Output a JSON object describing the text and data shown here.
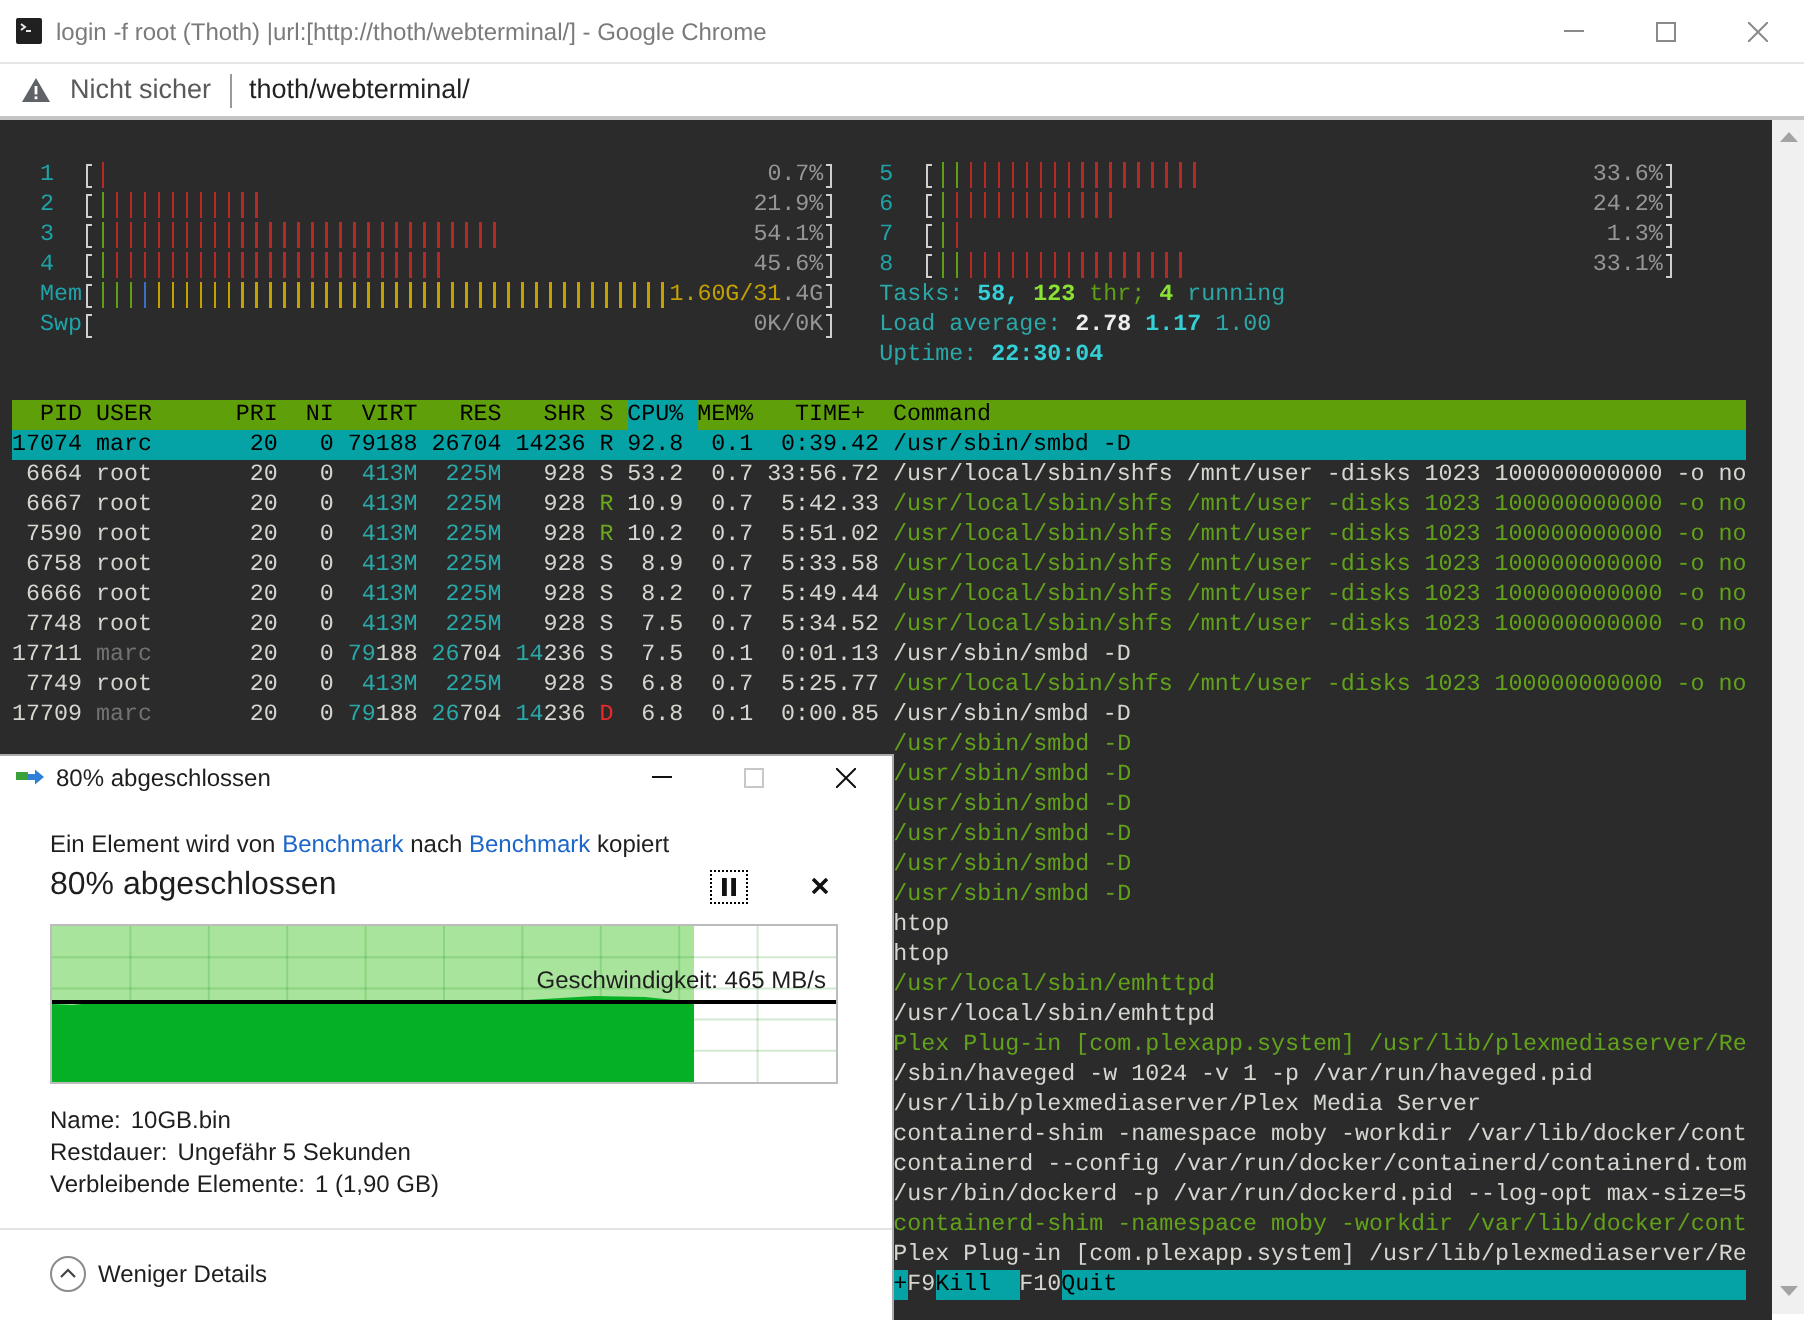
{
  "window": {
    "title": "login -f root (Thoth) |url:[http://thoth/webterminal/] - Google Chrome"
  },
  "address_bar": {
    "security_label": "Nicht sicher",
    "url": "thoth/webterminal/"
  },
  "terminal": {
    "left_meters": [
      {
        "label": "1",
        "segments": [
          {
            "color": "#b52a24",
            "level": 0.019
          }
        ],
        "reading": "0.7%"
      },
      {
        "label": "2",
        "segments": [
          {
            "color": "#5c9e14",
            "level": 0.019
          },
          {
            "color": "#b52a24",
            "level": 0.231
          }
        ],
        "reading": "21.9%"
      },
      {
        "label": "3",
        "segments": [
          {
            "color": "#5c9e14",
            "level": 0.019
          },
          {
            "color": "#b52a24",
            "level": 0.558
          }
        ],
        "reading": "54.1%"
      },
      {
        "label": "4",
        "segments": [
          {
            "color": "#5c9e14",
            "level": 0.019
          },
          {
            "color": "#b52a24",
            "level": 0.481
          }
        ],
        "reading": "45.6%"
      },
      {
        "label": "Mem",
        "segments": [
          {
            "color": "#5c9e14",
            "level": 0.058
          },
          {
            "color": "#3a6fc8",
            "level": 0.077
          },
          {
            "color": "#c4a000",
            "level": 0.942
          }
        ],
        "reading": "1.60G/31.4G"
      },
      {
        "label": "Swp",
        "reading": "0K/0K"
      }
    ],
    "right_meters": [
      {
        "label": "5",
        "segments": [
          {
            "color": "#5c9e14",
            "level": 0.038
          },
          {
            "color": "#b52a24",
            "level": 0.365
          }
        ],
        "reading": "33.6%"
      },
      {
        "label": "6",
        "segments": [
          {
            "color": "#5c9e14",
            "level": 0.019
          },
          {
            "color": "#b52a24",
            "level": 0.25
          }
        ],
        "reading": "24.2%"
      },
      {
        "label": "7",
        "segments": [
          {
            "color": "#5c9e14",
            "level": 0.019
          },
          {
            "color": "#b52a24",
            "level": 0.038
          }
        ],
        "reading": "1.3%"
      },
      {
        "label": "8",
        "segments": [
          {
            "color": "#5c9e14",
            "level": 0.038
          },
          {
            "color": "#b52a24",
            "level": 0.346
          }
        ],
        "reading": "33.1%"
      }
    ],
    "tasks": {
      "label": "Tasks:",
      "total": "58,",
      "threads": "123",
      "threads_label": "thr;",
      "running": "4",
      "running_label": "running"
    },
    "load_average": {
      "label": "Load average:",
      "values": [
        "2.78",
        "1.17",
        "1.00"
      ]
    },
    "uptime": {
      "label": "Uptime:",
      "value": "22:30:04"
    },
    "process_table": {
      "columns": [
        {
          "label": "PID",
          "sorted": false
        },
        {
          "label": "USER",
          "sorted": false
        },
        {
          "label": "PRI",
          "sorted": false
        },
        {
          "label": "NI",
          "sorted": false
        },
        {
          "label": "VIRT",
          "sorted": false
        },
        {
          "label": "RES",
          "sorted": false
        },
        {
          "label": "SHR",
          "sorted": false
        },
        {
          "label": "S",
          "sorted": false
        },
        {
          "label": "CPU%",
          "sorted": true
        },
        {
          "label": "MEM%",
          "sorted": false
        },
        {
          "label": "TIME+",
          "sorted": false
        },
        {
          "label": "Command",
          "sorted": false
        }
      ],
      "rows": [
        {
          "pid": "17074",
          "user": "marc",
          "pri": "20",
          "ni": "0",
          "virt": "79188",
          "res": "26704",
          "shr": "14236",
          "state": {
            "text": "R"
          },
          "cpu": "92.8",
          "mem": "0.1",
          "time": "0:39.42",
          "command": "/usr/sbin/smbd -D",
          "selected": true
        },
        {
          "pid": "6664",
          "user": "root",
          "user_dim": false,
          "pri": "20",
          "ni": "0",
          "virt": "413M",
          "res": "225M",
          "shr": "928",
          "state": {
            "text": "S",
            "color": "#d3d7cf"
          },
          "cpu": "53.2",
          "mem": "0.7",
          "time": "33:56.72",
          "command": "/usr/local/sbin/shfs /mnt/user -disks 1023 100000000000 -o no",
          "thread": false,
          "selected": false
        },
        {
          "pid": "6667",
          "user": "root",
          "user_dim": false,
          "pri": "20",
          "ni": "0",
          "virt": "413M",
          "res": "225M",
          "shr": "928",
          "state": {
            "text": "R",
            "color": "#6aa81c"
          },
          "cpu": "10.9",
          "mem": "0.7",
          "time": "5:42.33",
          "command": "/usr/local/sbin/shfs /mnt/user -disks 1023 100000000000 -o no",
          "thread": true,
          "selected": false
        },
        {
          "pid": "7590",
          "user": "root",
          "user_dim": false,
          "pri": "20",
          "ni": "0",
          "virt": "413M",
          "res": "225M",
          "shr": "928",
          "state": {
            "text": "R",
            "color": "#6aa81c"
          },
          "cpu": "10.2",
          "mem": "0.7",
          "time": "5:51.02",
          "command": "/usr/local/sbin/shfs /mnt/user -disks 1023 100000000000 -o no",
          "thread": true,
          "selected": false
        },
        {
          "pid": "6758",
          "user": "root",
          "user_dim": false,
          "pri": "20",
          "ni": "0",
          "virt": "413M",
          "res": "225M",
          "shr": "928",
          "state": {
            "text": "S",
            "color": "#d3d7cf"
          },
          "cpu": "8.9",
          "mem": "0.7",
          "time": "5:33.58",
          "command": "/usr/local/sbin/shfs /mnt/user -disks 1023 100000000000 -o no",
          "thread": true,
          "selected": false
        },
        {
          "pid": "6666",
          "user": "root",
          "user_dim": false,
          "pri": "20",
          "ni": "0",
          "virt": "413M",
          "res": "225M",
          "shr": "928",
          "state": {
            "text": "S",
            "color": "#d3d7cf"
          },
          "cpu": "8.2",
          "mem": "0.7",
          "time": "5:49.44",
          "command": "/usr/local/sbin/shfs /mnt/user -disks 1023 100000000000 -o no",
          "thread": true,
          "selected": false
        },
        {
          "pid": "7748",
          "user": "root",
          "user_dim": false,
          "pri": "20",
          "ni": "0",
          "virt": "413M",
          "res": "225M",
          "shr": "928",
          "state": {
            "text": "S",
            "color": "#d3d7cf"
          },
          "cpu": "7.5",
          "mem": "0.7",
          "time": "5:34.52",
          "command": "/usr/local/sbin/shfs /mnt/user -disks 1023 100000000000 -o no",
          "thread": true,
          "selected": false
        },
        {
          "pid": "17711",
          "user": "marc",
          "user_dim": true,
          "pri": "20",
          "ni": "0",
          "virt": "79188",
          "res": "26704",
          "shr": "14236",
          "state": {
            "text": "S",
            "color": "#d3d7cf"
          },
          "cpu": "7.5",
          "mem": "0.1",
          "time": "0:01.13",
          "command": "/usr/sbin/smbd -D",
          "thread": false,
          "selected": false
        },
        {
          "pid": "7749",
          "user": "root",
          "user_dim": false,
          "pri": "20",
          "ni": "0",
          "virt": "413M",
          "res": "225M",
          "shr": "928",
          "state": {
            "text": "S",
            "color": "#d3d7cf"
          },
          "cpu": "6.8",
          "mem": "0.7",
          "time": "5:25.77",
          "command": "/usr/local/sbin/shfs /mnt/user -disks 1023 100000000000 -o no",
          "thread": true,
          "selected": false
        },
        {
          "pid": "17709",
          "user": "marc",
          "user_dim": true,
          "pri": "20",
          "ni": "0",
          "virt": "79188",
          "res": "26704",
          "shr": "14236",
          "state": {
            "text": "D",
            "color": "#ef2929"
          },
          "cpu": "6.8",
          "mem": "0.1",
          "time": "0:00.85",
          "command": "/usr/sbin/smbd -D",
          "thread": false,
          "selected": false
        },
        {
          "command": "/usr/sbin/smbd -D",
          "thread": true,
          "selected": false
        },
        {
          "command": "/usr/sbin/smbd -D",
          "thread": true,
          "selected": false
        },
        {
          "command": "/usr/sbin/smbd -D",
          "thread": true,
          "selected": false
        },
        {
          "command": "/usr/sbin/smbd -D",
          "thread": true,
          "selected": false
        },
        {
          "command": "/usr/sbin/smbd -D",
          "thread": true,
          "selected": false
        },
        {
          "command": "/usr/sbin/smbd -D",
          "thread": true,
          "selected": false
        },
        {
          "command": "htop",
          "thread": false,
          "selected": false
        },
        {
          "command": "htop",
          "thread": false,
          "selected": false
        },
        {
          "command": "/usr/local/sbin/emhttpd",
          "thread": true,
          "selected": false
        },
        {
          "command": "/usr/local/sbin/emhttpd",
          "thread": false,
          "selected": false
        },
        {
          "command": "Plex Plug-in [com.plexapp.system] /usr/lib/plexmediaserver/Re",
          "thread": true,
          "selected": false
        },
        {
          "command": "/sbin/haveged -w 1024 -v 1 -p /var/run/haveged.pid",
          "thread": false,
          "selected": false
        },
        {
          "command": "/usr/lib/plexmediaserver/Plex Media Server",
          "thread": false,
          "selected": false
        },
        {
          "command": "containerd-shim -namespace moby -workdir /var/lib/docker/cont",
          "thread": false,
          "selected": false
        },
        {
          "command": "containerd --config /var/run/docker/containerd/containerd.tom",
          "thread": false,
          "selected": false
        },
        {
          "command": "/usr/bin/dockerd -p /var/run/dockerd.pid --log-opt max-size=5",
          "thread": false,
          "selected": false
        },
        {
          "command": "containerd-shim -namespace moby -workdir /var/lib/docker/cont",
          "thread": true,
          "selected": false
        },
        {
          "command": "Plex Plug-in [com.plexapp.system] /usr/lib/plexmediaserver/Re",
          "thread": false,
          "selected": false
        }
      ]
    },
    "function_bar": [
      {
        "kind": "label",
        "text": "+"
      },
      {
        "kind": "key",
        "text": "F9"
      },
      {
        "kind": "label",
        "text": "Kill"
      },
      {
        "kind": "key",
        "text": "F10"
      },
      {
        "kind": "label",
        "text": "Quit"
      }
    ]
  },
  "copy_dialog": {
    "title": "80% abgeschlossen",
    "message": [
      {
        "kind": "text",
        "text": "Ein Element wird von"
      },
      {
        "kind": "link",
        "text": "Benchmark"
      },
      {
        "kind": "text",
        "text": "nach"
      },
      {
        "kind": "link",
        "text": "Benchmark"
      },
      {
        "kind": "text",
        "text": "kopiert"
      }
    ],
    "status": "80% abgeschlossen",
    "progress": {
      "level": 0.82,
      "speed": "Geschwindigkeit: 465 MB/s"
    },
    "details": [
      {
        "label": "Name:",
        "value": "10GB.bin"
      },
      {
        "label": "Restdauer:",
        "value": "Ungefähr 5 Sekunden"
      },
      {
        "label": "Verbleibende Elemente:",
        "value": "1 (1,90 GB)"
      }
    ],
    "details_toggle": {
      "label": "Weniger Details",
      "expanded": true
    }
  }
}
